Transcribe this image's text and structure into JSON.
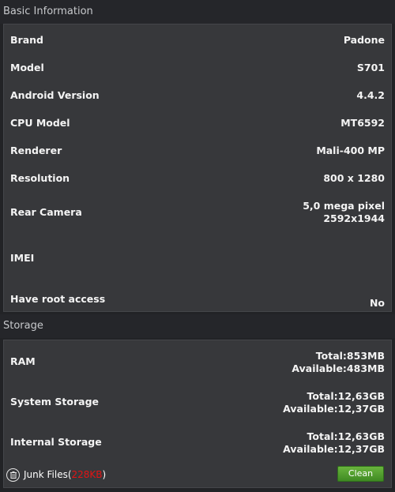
{
  "basic_info": {
    "title": "Basic Information",
    "rows": [
      {
        "label": "Brand",
        "value": "Padone"
      },
      {
        "label": "Model",
        "value": "S701"
      },
      {
        "label": "Android Version",
        "value": "4.4.2"
      },
      {
        "label": "CPU Model",
        "value": "MT6592"
      },
      {
        "label": "Renderer",
        "value": "Mali-400 MP"
      },
      {
        "label": "Resolution",
        "value": "800 x 1280"
      },
      {
        "label": "Rear Camera",
        "value_line1": "5,0 mega pixel",
        "value_line2": "2592x1944"
      },
      {
        "label": "IMEI",
        "value": ""
      },
      {
        "label": "Have root access",
        "value": "No"
      }
    ]
  },
  "storage": {
    "title": "Storage",
    "rows": [
      {
        "label": "RAM",
        "total": "Total:853MB",
        "available": "Available:483MB"
      },
      {
        "label": "System Storage",
        "total": "Total:12,63GB",
        "available": "Available:12,37GB"
      },
      {
        "label": "Internal Storage",
        "total": "Total:12,63GB",
        "available": "Available:12,37GB"
      }
    ],
    "junk": {
      "label": "Junk Files(",
      "size": "228KB",
      "suffix": ")",
      "icon": "trash-icon"
    },
    "clean_label": "Clean"
  },
  "colors": {
    "background": "#222326",
    "panel": "#37383b",
    "accent_green": "#4f9b2c",
    "junk_red": "#e21414"
  }
}
